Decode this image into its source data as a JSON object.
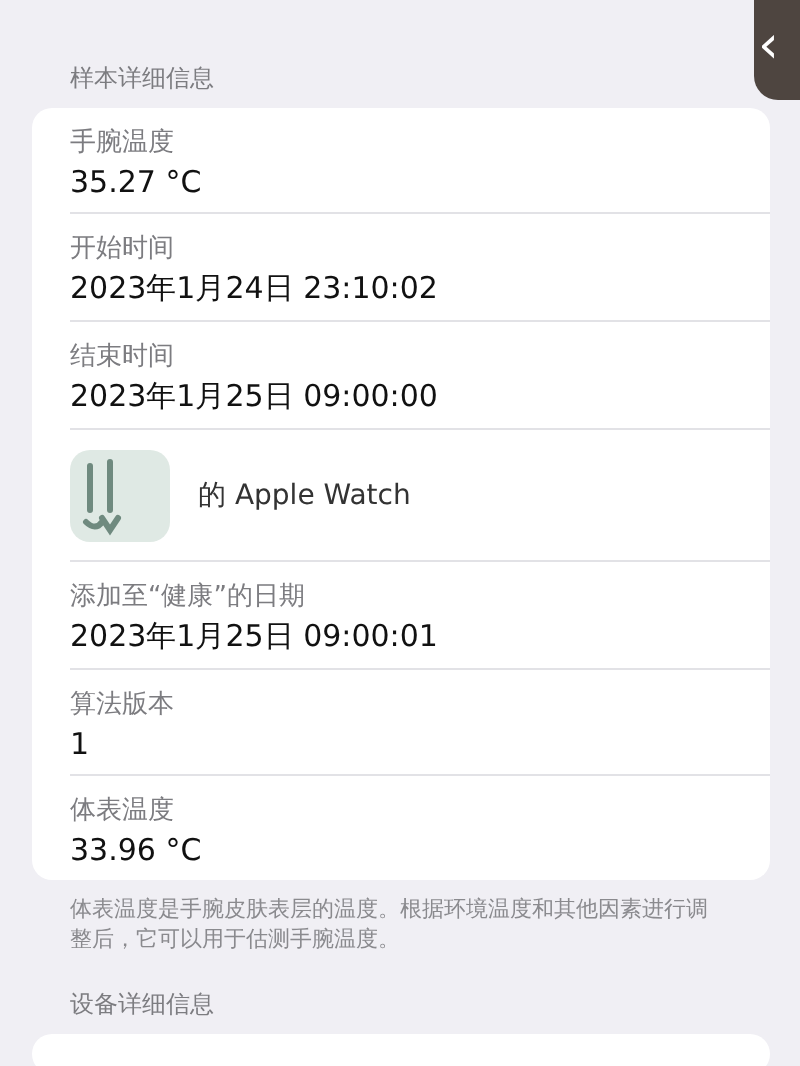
{
  "back_button": {
    "label": "‹"
  },
  "sample_section": {
    "header": "样本详细信息",
    "rows": [
      {
        "kind": "field",
        "label": "手腕温度",
        "value": "35.27 °C"
      },
      {
        "kind": "field",
        "label": "开始时间",
        "value": "2023年1月24日 23:10:02"
      },
      {
        "kind": "field",
        "label": "结束时间",
        "value": "2023年1月25日 09:00:00"
      },
      {
        "kind": "source",
        "value": "的 Apple Watch"
      },
      {
        "kind": "field",
        "label": "添加至“健康”的日期",
        "value": "2023年1月25日 09:00:01"
      },
      {
        "kind": "field",
        "label": "算法版本",
        "value": "1"
      },
      {
        "kind": "field",
        "label": "体表温度",
        "value": "33.96 °C"
      }
    ],
    "footer": "体表温度是手腕皮肤表层的温度。根据环境温度和其他因素进行调整后，它可以用于估测手腕温度。"
  },
  "device_section": {
    "header": "设备详细信息"
  }
}
